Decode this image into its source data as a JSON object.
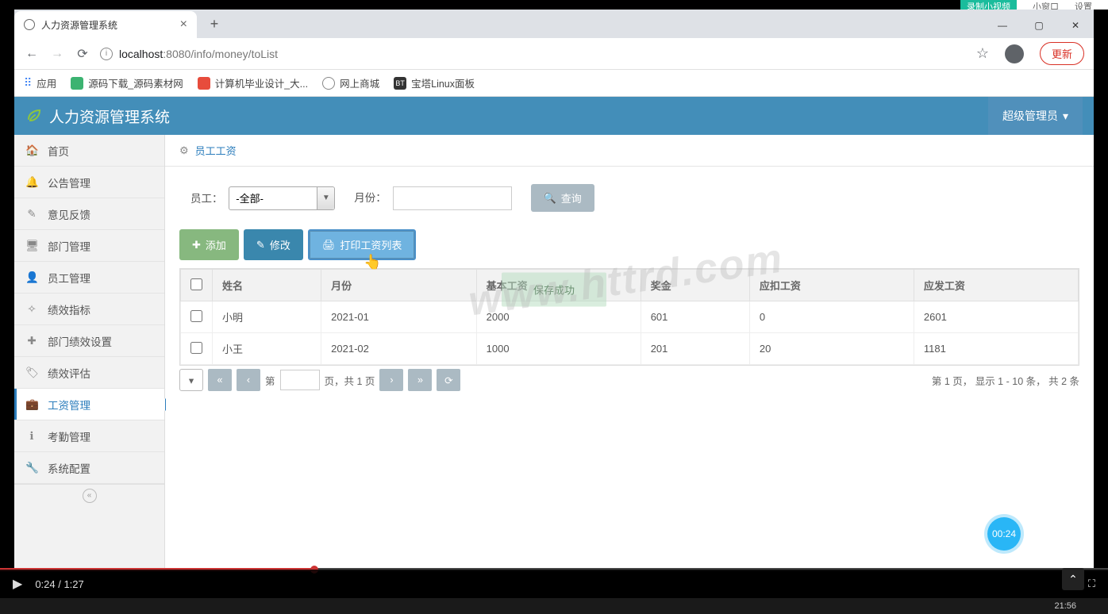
{
  "os_top": {
    "record": "录制小视频",
    "small_window": "小窗口",
    "settings": "设置"
  },
  "browser": {
    "tab_title": "人力资源管理系统",
    "url_host": "localhost",
    "url_port": ":8080",
    "url_path": "/info/money/toList",
    "update_btn": "更新"
  },
  "bookmarks": {
    "apps": "应用",
    "items": [
      {
        "label": "源码下载_源码素材网"
      },
      {
        "label": "计算机毕业设计_大..."
      },
      {
        "label": "网上商城"
      },
      {
        "label": "宝塔Linux面板"
      }
    ]
  },
  "app": {
    "title": "人力资源管理系统",
    "user_role": "超级管理员"
  },
  "sidebar": {
    "items": [
      {
        "label": "首页",
        "icon": "🏠"
      },
      {
        "label": "公告管理",
        "icon": "🔔"
      },
      {
        "label": "意见反馈",
        "icon": "✎"
      },
      {
        "label": "部门管理",
        "icon": "🖥"
      },
      {
        "label": "员工管理",
        "icon": "👤"
      },
      {
        "label": "绩效指标",
        "icon": "✧"
      },
      {
        "label": "部门绩效设置",
        "icon": "✚"
      },
      {
        "label": "绩效评估",
        "icon": "🏷"
      },
      {
        "label": "工资管理",
        "icon": "💼",
        "active": true
      },
      {
        "label": "考勤管理",
        "icon": "ℹ"
      },
      {
        "label": "系统配置",
        "icon": "🔧"
      }
    ]
  },
  "breadcrumb": {
    "label": "员工工资"
  },
  "filter": {
    "employee_label": "员工：",
    "employee_value": "-全部-",
    "month_label": "月份：",
    "month_value": "",
    "search_btn": "查询"
  },
  "toolbar": {
    "add": "添加",
    "edit": "修改",
    "print": "打印工资列表"
  },
  "table": {
    "headers": [
      "",
      "姓名",
      "月份",
      "基本工资",
      "奖金",
      "应扣工资",
      "应发工资"
    ],
    "rows": [
      {
        "name": "小明",
        "month": "2021-01",
        "base": "2000",
        "bonus": "601",
        "deduct": "0",
        "net": "2601"
      },
      {
        "name": "小王",
        "month": "2021-02",
        "base": "1000",
        "bonus": "201",
        "deduct": "20",
        "net": "1181"
      }
    ]
  },
  "pager": {
    "page_prefix": "第",
    "page_input": "",
    "page_suffix": "页，共 1 页",
    "info": "第 1 页，  显示 1 - 10 条，  共 2 条"
  },
  "toast": "保存成功",
  "watermark": "www.httrd.com",
  "record_bubble": "00:24",
  "video": {
    "time": "0:24 / 1:27"
  },
  "taskbar": {
    "clock": "21:56"
  }
}
